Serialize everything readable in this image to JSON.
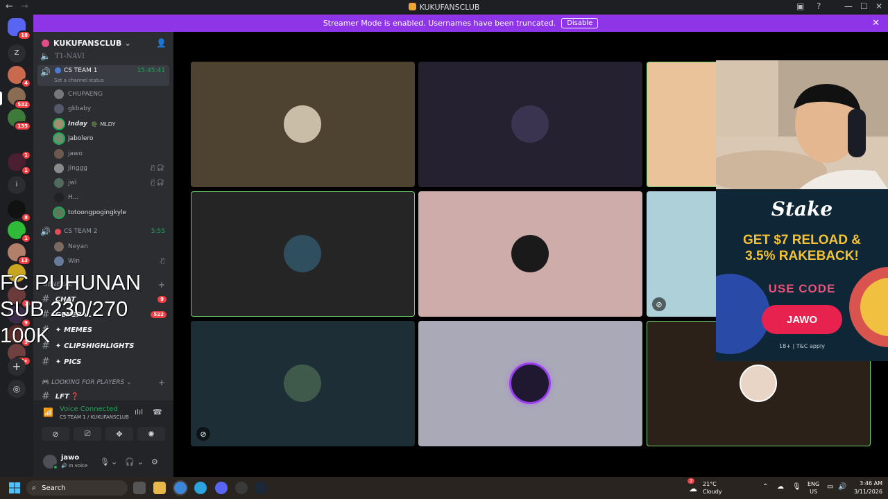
{
  "window": {
    "title": "KUKUFANSCLUB"
  },
  "banner": {
    "text": "Streamer Mode is enabled. Usernames have been truncated.",
    "button": "Disable"
  },
  "rail": {
    "top_label": "Z",
    "info_label": "i",
    "badges": [
      "18",
      "4",
      "532",
      "135",
      "1",
      "1",
      "8",
      "1",
      "13",
      "1",
      "9",
      "5",
      "4",
      "2K+"
    ]
  },
  "guild": {
    "name": "KUKUFANSCLUB"
  },
  "channels": {
    "partial_top": "T1-NAVI",
    "team1": {
      "name": "CS TEAM 1",
      "timer": "15:45:41",
      "status_hint": "Set a channel status",
      "members": [
        {
          "name": "CHUPAENG"
        },
        {
          "name": "gkbaby"
        },
        {
          "name": "Inday",
          "tag": "MLDY"
        },
        {
          "name": "Jabolero"
        },
        {
          "name": "jawo"
        },
        {
          "name": "Jinggg"
        },
        {
          "name": "jwl"
        },
        {
          "name": "H..."
        },
        {
          "name": "totoongpogingkyle"
        }
      ]
    },
    "team2": {
      "name": "CS TEAM 2",
      "timer": "5:55",
      "members": [
        {
          "name": "Neyan"
        },
        {
          "name": "Win"
        }
      ]
    },
    "general_cat": "GENERAL",
    "text_channels": [
      {
        "name": "CHAT",
        "count": "9"
      },
      {
        "name": "GENERAL",
        "count": "522"
      },
      {
        "name": "MEMES"
      },
      {
        "name": "CLIPSHIGHLIGHTS"
      },
      {
        "name": "PICS"
      }
    ],
    "lfp_cat": "LOOKING FOR PLAYERS",
    "lft": "LFT"
  },
  "overlay": {
    "line1": "FC PUHUNAN",
    "line2": "SUB 230/270",
    "line3": "100K"
  },
  "voice": {
    "status": "Voice Connected",
    "location": "CS TEAM 1 / KUKUFANSCLUB"
  },
  "user": {
    "name": "jawo",
    "status": "In voice"
  },
  "ad": {
    "brand": "Stake",
    "headline1": "GET $7 RELOAD &",
    "headline2": "3.5% RAKEBACK!",
    "code_label": "USE CODE",
    "code": "JAWO",
    "footer": "18+ | T&C apply"
  },
  "taskbar": {
    "search": "Search",
    "weather_temp": "21°C",
    "weather_desc": "Cloudy",
    "lang1": "ENG",
    "lang2": "US",
    "time": "3:46 AM",
    "date": "3/11/2026",
    "weather_badge": "2"
  },
  "colors": {
    "accent": "#8f35e8",
    "speaking": "#23a55a",
    "badge": "#f23f43"
  }
}
